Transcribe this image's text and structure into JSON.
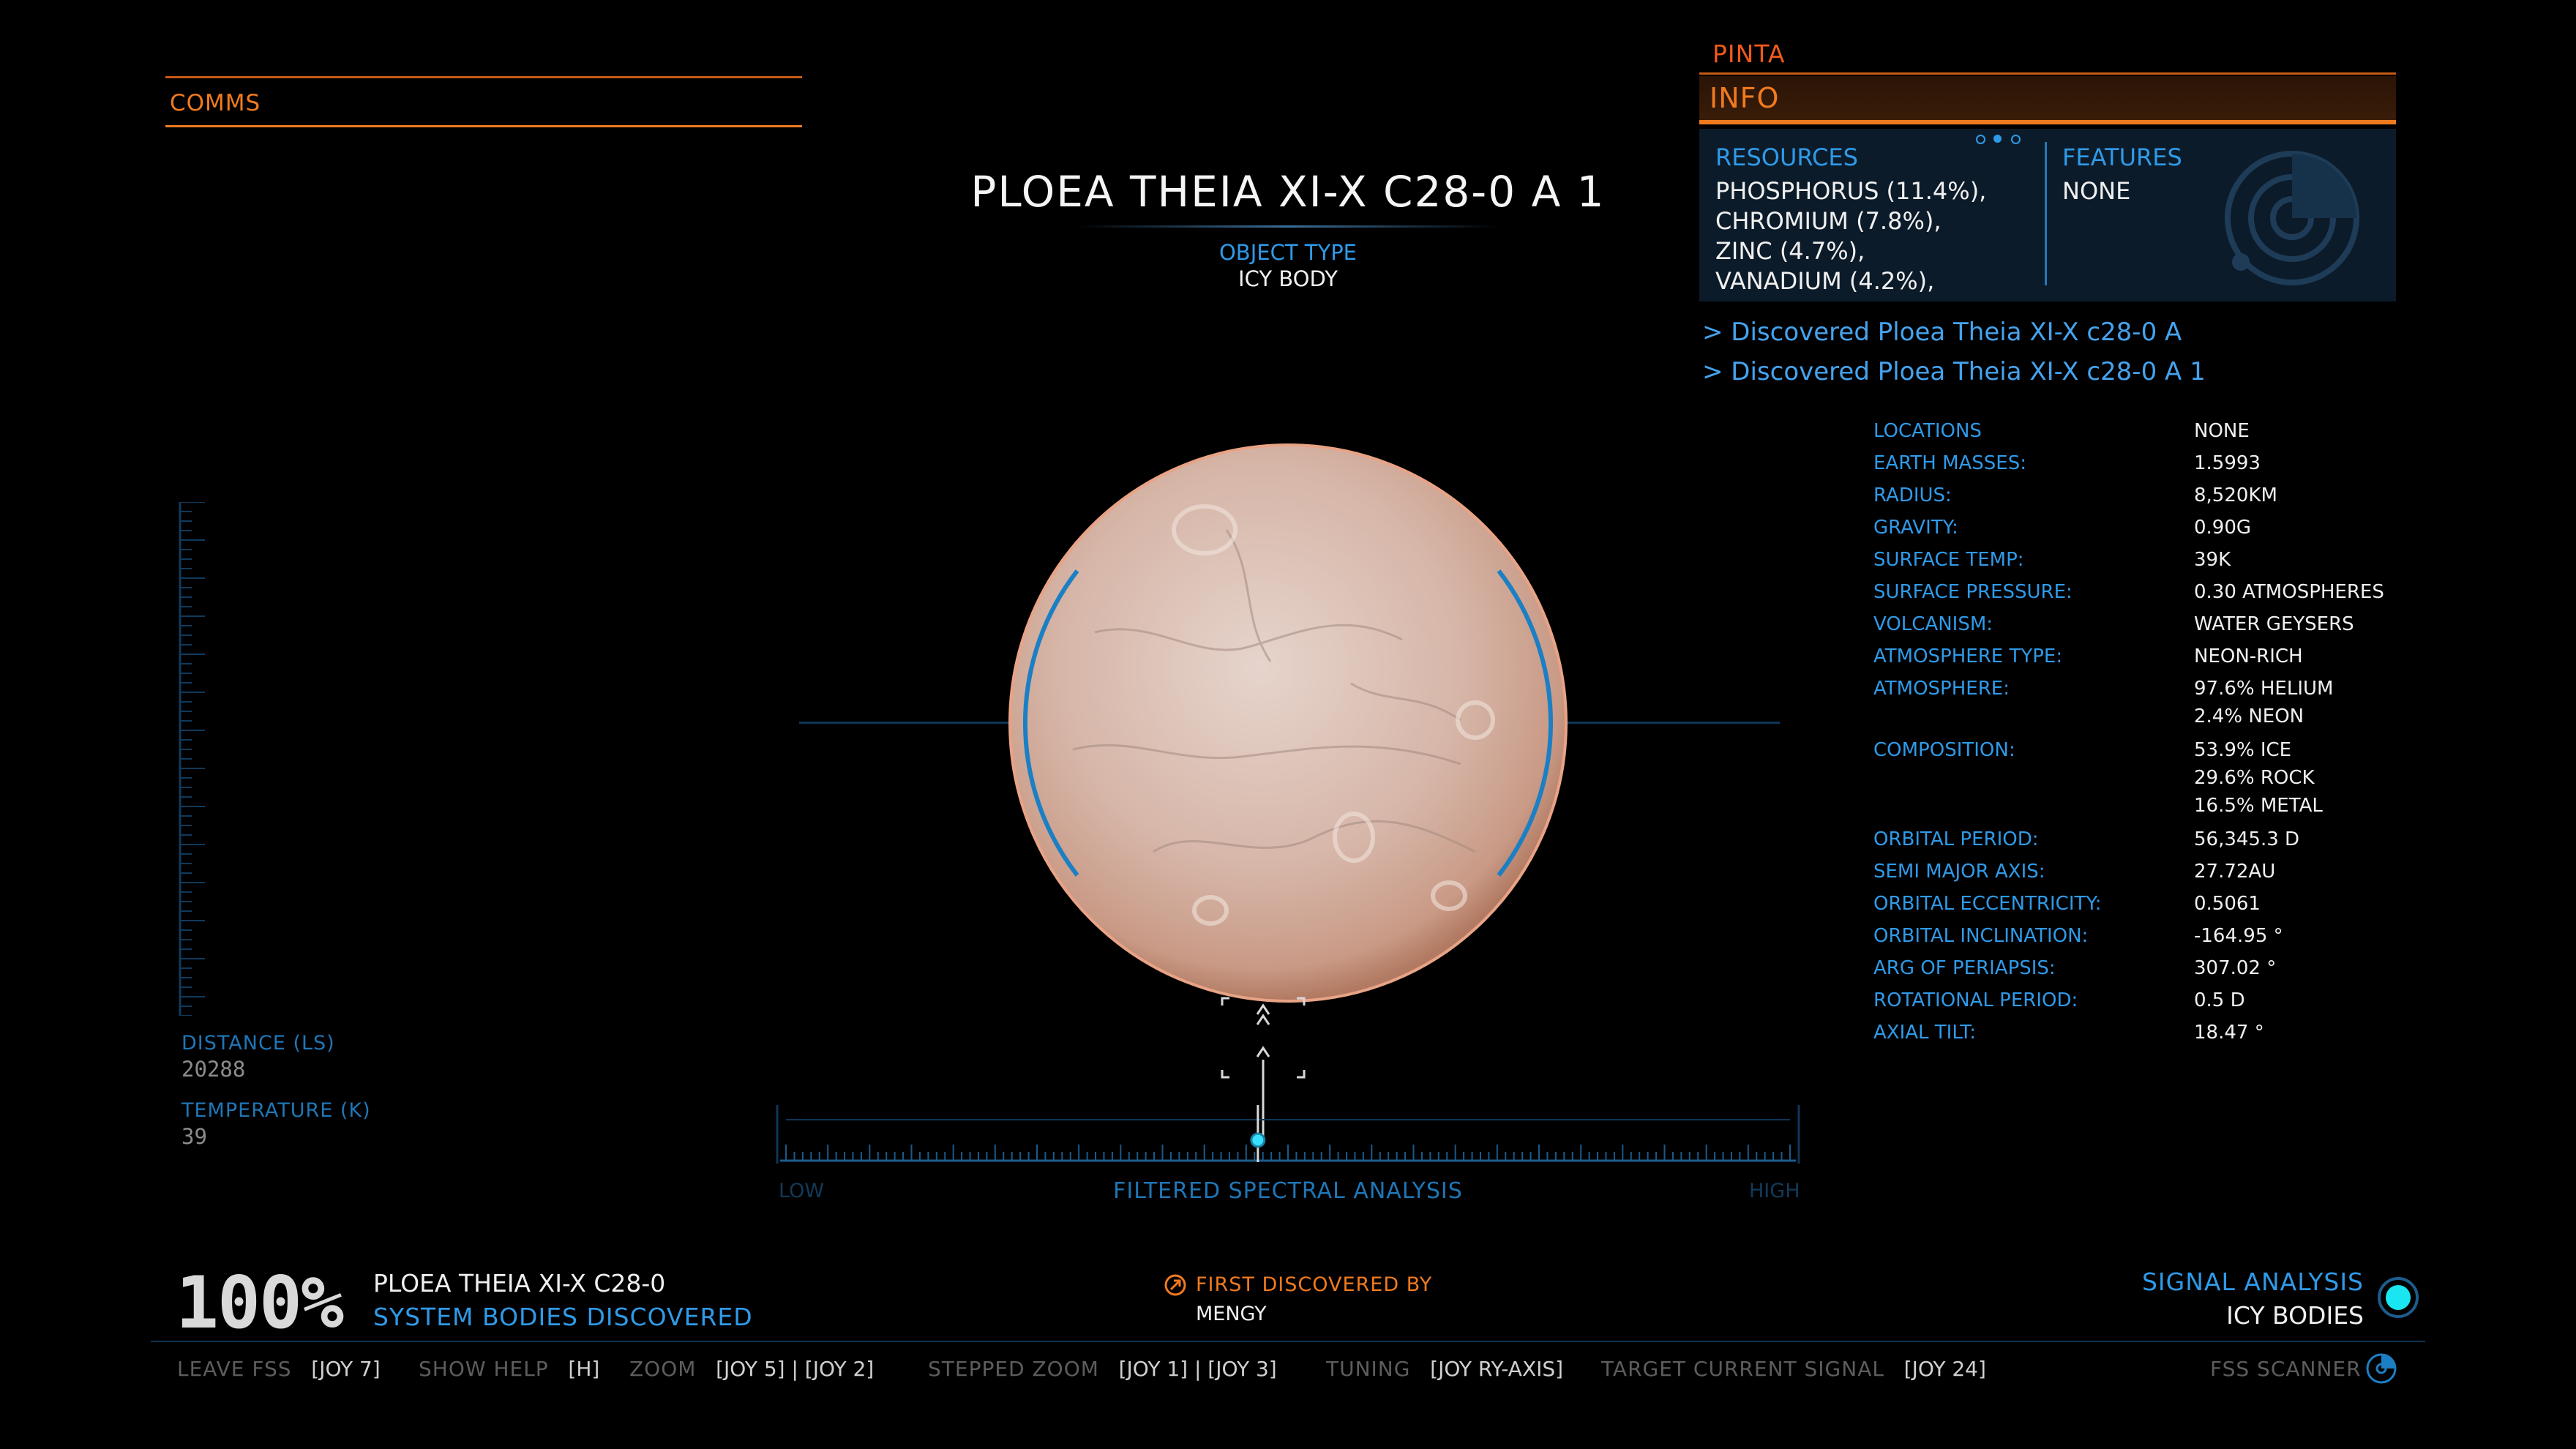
{
  "comms": {
    "label": "COMMS"
  },
  "body": {
    "title": "PLOEA THEIA XI-X C28-0 A 1",
    "object_type_label": "OBJECT TYPE",
    "object_type_value": "ICY BODY"
  },
  "panel": {
    "system_name": "PINTA",
    "tab_label": "INFO",
    "resources_label": "RESOURCES",
    "resources": [
      "PHOSPHORUS (11.4%),",
      "CHROMIUM (7.8%),",
      "ZINC (4.7%),",
      "VANADIUM (4.2%),"
    ],
    "features_label": "FEATURES",
    "features_value": "NONE",
    "page_dots": {
      "count": 3,
      "active": 1
    }
  },
  "discoveries": [
    "> Discovered Ploea Theia XI-X c28-0 A",
    "> Discovered Ploea Theia XI-X c28-0 A 1"
  ],
  "details": [
    {
      "label": "LOCATIONS",
      "values": [
        "NONE"
      ]
    },
    {
      "label": "EARTH MASSES:",
      "values": [
        "1.5993"
      ]
    },
    {
      "label": "RADIUS:",
      "values": [
        "8,520KM"
      ]
    },
    {
      "label": "GRAVITY:",
      "values": [
        "0.90G"
      ]
    },
    {
      "label": "SURFACE TEMP:",
      "values": [
        "39K"
      ]
    },
    {
      "label": "SURFACE PRESSURE:",
      "values": [
        "0.30 ATMOSPHERES"
      ]
    },
    {
      "label": "VOLCANISM:",
      "values": [
        "WATER GEYSERS"
      ]
    },
    {
      "label": "ATMOSPHERE TYPE:",
      "values": [
        "NEON-RICH"
      ]
    },
    {
      "label": "ATMOSPHERE:",
      "values": [
        "97.6% HELIUM",
        "2.4% NEON"
      ]
    },
    {
      "label": "COMPOSITION:",
      "values": [
        "53.9% ICE",
        "29.6% ROCK",
        "16.5% METAL"
      ]
    },
    {
      "label": "ORBITAL PERIOD:",
      "values": [
        "56,345.3 D"
      ]
    },
    {
      "label": "SEMI MAJOR AXIS:",
      "values": [
        "27.72AU"
      ]
    },
    {
      "label": "ORBITAL ECCENTRICITY:",
      "values": [
        "0.5061"
      ]
    },
    {
      "label": "ORBITAL INCLINATION:",
      "values": [
        "-164.95 °"
      ]
    },
    {
      "label": "ARG OF PERIAPSIS:",
      "values": [
        "307.02 °"
      ]
    },
    {
      "label": "ROTATIONAL PERIOD:",
      "values": [
        "0.5 D"
      ]
    },
    {
      "label": "AXIAL TILT:",
      "values": [
        "18.47 °"
      ]
    }
  ],
  "left_readout": {
    "distance_label": "DISTANCE (LS)",
    "distance_value": "20288",
    "temperature_label": "TEMPERATURE (K)",
    "temperature_value": "39"
  },
  "spectral": {
    "low_label": "LOW",
    "title": "FILTERED SPECTRAL ANALYSIS",
    "high_label": "HIGH",
    "marker_position": 0.47
  },
  "bottom": {
    "percent": "100%",
    "system_name": "PLOEA THEIA XI-X C28-0",
    "bodies_label": "SYSTEM BODIES DISCOVERED",
    "first_discovered_label": "FIRST DISCOVERED BY",
    "first_discovered_value": "MENGY",
    "signal_label": "SIGNAL ANALYSIS",
    "signal_value": "ICY BODIES",
    "fss_label": "FSS SCANNER"
  },
  "keybinds": [
    {
      "action": "LEAVE FSS",
      "keys": "[JOY 7]"
    },
    {
      "action": "SHOW HELP",
      "keys": "[H]"
    },
    {
      "action": "ZOOM",
      "keys": "[JOY 5] |  [JOY 2]"
    },
    {
      "action": "STEPPED ZOOM",
      "keys": "[JOY 1] |  [JOY 3]"
    },
    {
      "action": "TUNING",
      "keys": "[JOY RY-AXIS]"
    },
    {
      "action": "TARGET CURRENT SIGNAL",
      "keys": "[JOY 24]"
    }
  ],
  "colors": {
    "orange": "#f07a1f",
    "blue": "#2f9ae8",
    "planet": "#d8b3a6",
    "background": "#000000"
  },
  "icons": [
    "signal-orb-icon",
    "fss-scanner-icon",
    "first-discovered-icon",
    "radar-icon"
  ]
}
